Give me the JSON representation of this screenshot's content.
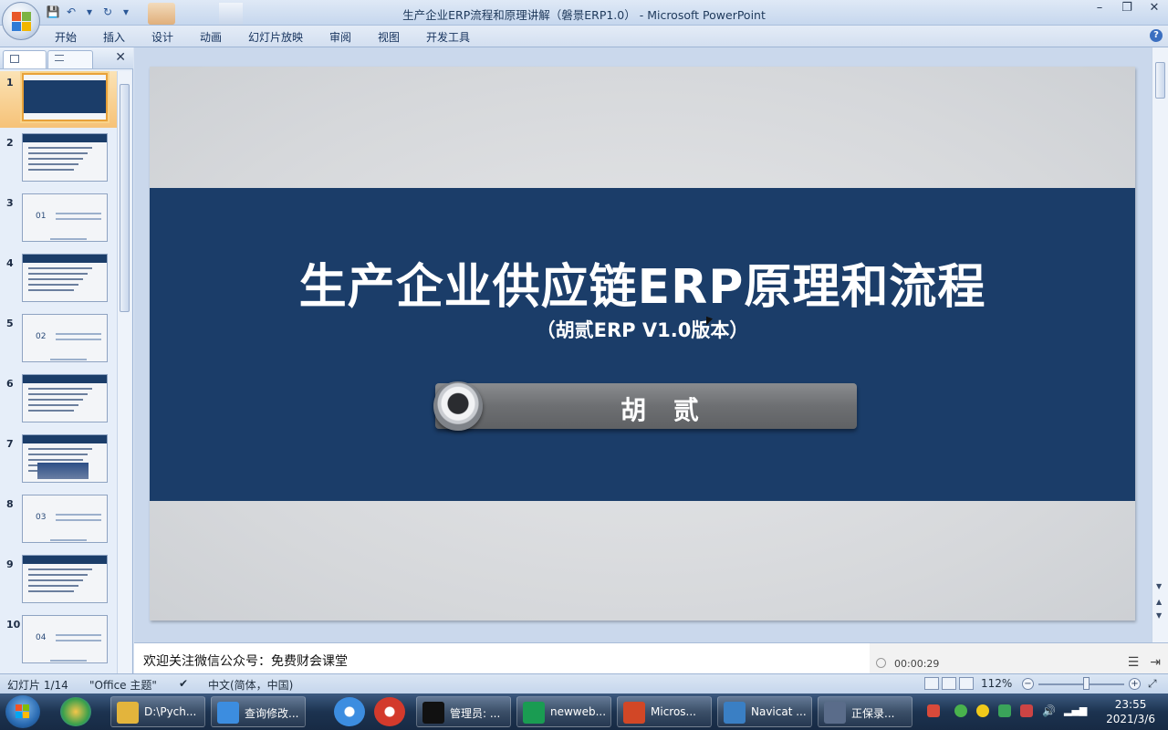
{
  "window": {
    "title": "生产企业ERP流程和原理讲解（磐景ERP1.0） - Microsoft PowerPoint",
    "controls": {
      "minimize": "–",
      "restore": "❐",
      "close": "✕"
    }
  },
  "ribbon": {
    "tabs": [
      "开始",
      "插入",
      "设计",
      "动画",
      "幻灯片放映",
      "审阅",
      "视图",
      "开发工具"
    ],
    "help": "?"
  },
  "left_pane": {
    "close": "✕",
    "slides": [
      {
        "num": "1",
        "kind": "title"
      },
      {
        "num": "2",
        "kind": "toc"
      },
      {
        "num": "3",
        "kind": "section",
        "label": "01"
      },
      {
        "num": "4",
        "kind": "content"
      },
      {
        "num": "5",
        "kind": "section",
        "label": "02"
      },
      {
        "num": "6",
        "kind": "content"
      },
      {
        "num": "7",
        "kind": "content-image"
      },
      {
        "num": "8",
        "kind": "section",
        "label": "03"
      },
      {
        "num": "9",
        "kind": "content-table"
      },
      {
        "num": "10",
        "kind": "section",
        "label": "04"
      }
    ],
    "selected_index": 0
  },
  "slide": {
    "title": "生产企业供应链ERP原理和流程",
    "subtitle": "（胡贰ERP V1.0版本）",
    "author": "胡 贰",
    "colors": {
      "band": "#1b3d69",
      "background": "#d9dadd",
      "pill": "#6d6f72"
    }
  },
  "notes": {
    "text": "欢迎关注微信公众号：免费财会课堂"
  },
  "recorder": {
    "time": "00:00:29"
  },
  "status": {
    "slide_count": "幻灯片 1/14",
    "theme": "\"Office 主题\"",
    "language": "中文(简体，中国)",
    "zoom": "112%",
    "zoom_fraction": 0.55
  },
  "taskbar": {
    "items": [
      {
        "label": "D:\\Pych...",
        "icon_color": "#e3b43c"
      },
      {
        "label": "查询修改...",
        "icon_color": "#3c8de0"
      },
      {
        "label": "管理员: ...",
        "icon_color": "#111111"
      },
      {
        "label": "newweb...",
        "icon_color": "#1a9c52"
      },
      {
        "label": "Micros...",
        "icon_color": "#d24726"
      },
      {
        "label": "Navicat ...",
        "icon_color": "#3a7fc4"
      },
      {
        "label": "正保录...",
        "icon_color": "#5a6c8a"
      }
    ],
    "clock_time": "23:55",
    "clock_date": "2021/3/6"
  }
}
